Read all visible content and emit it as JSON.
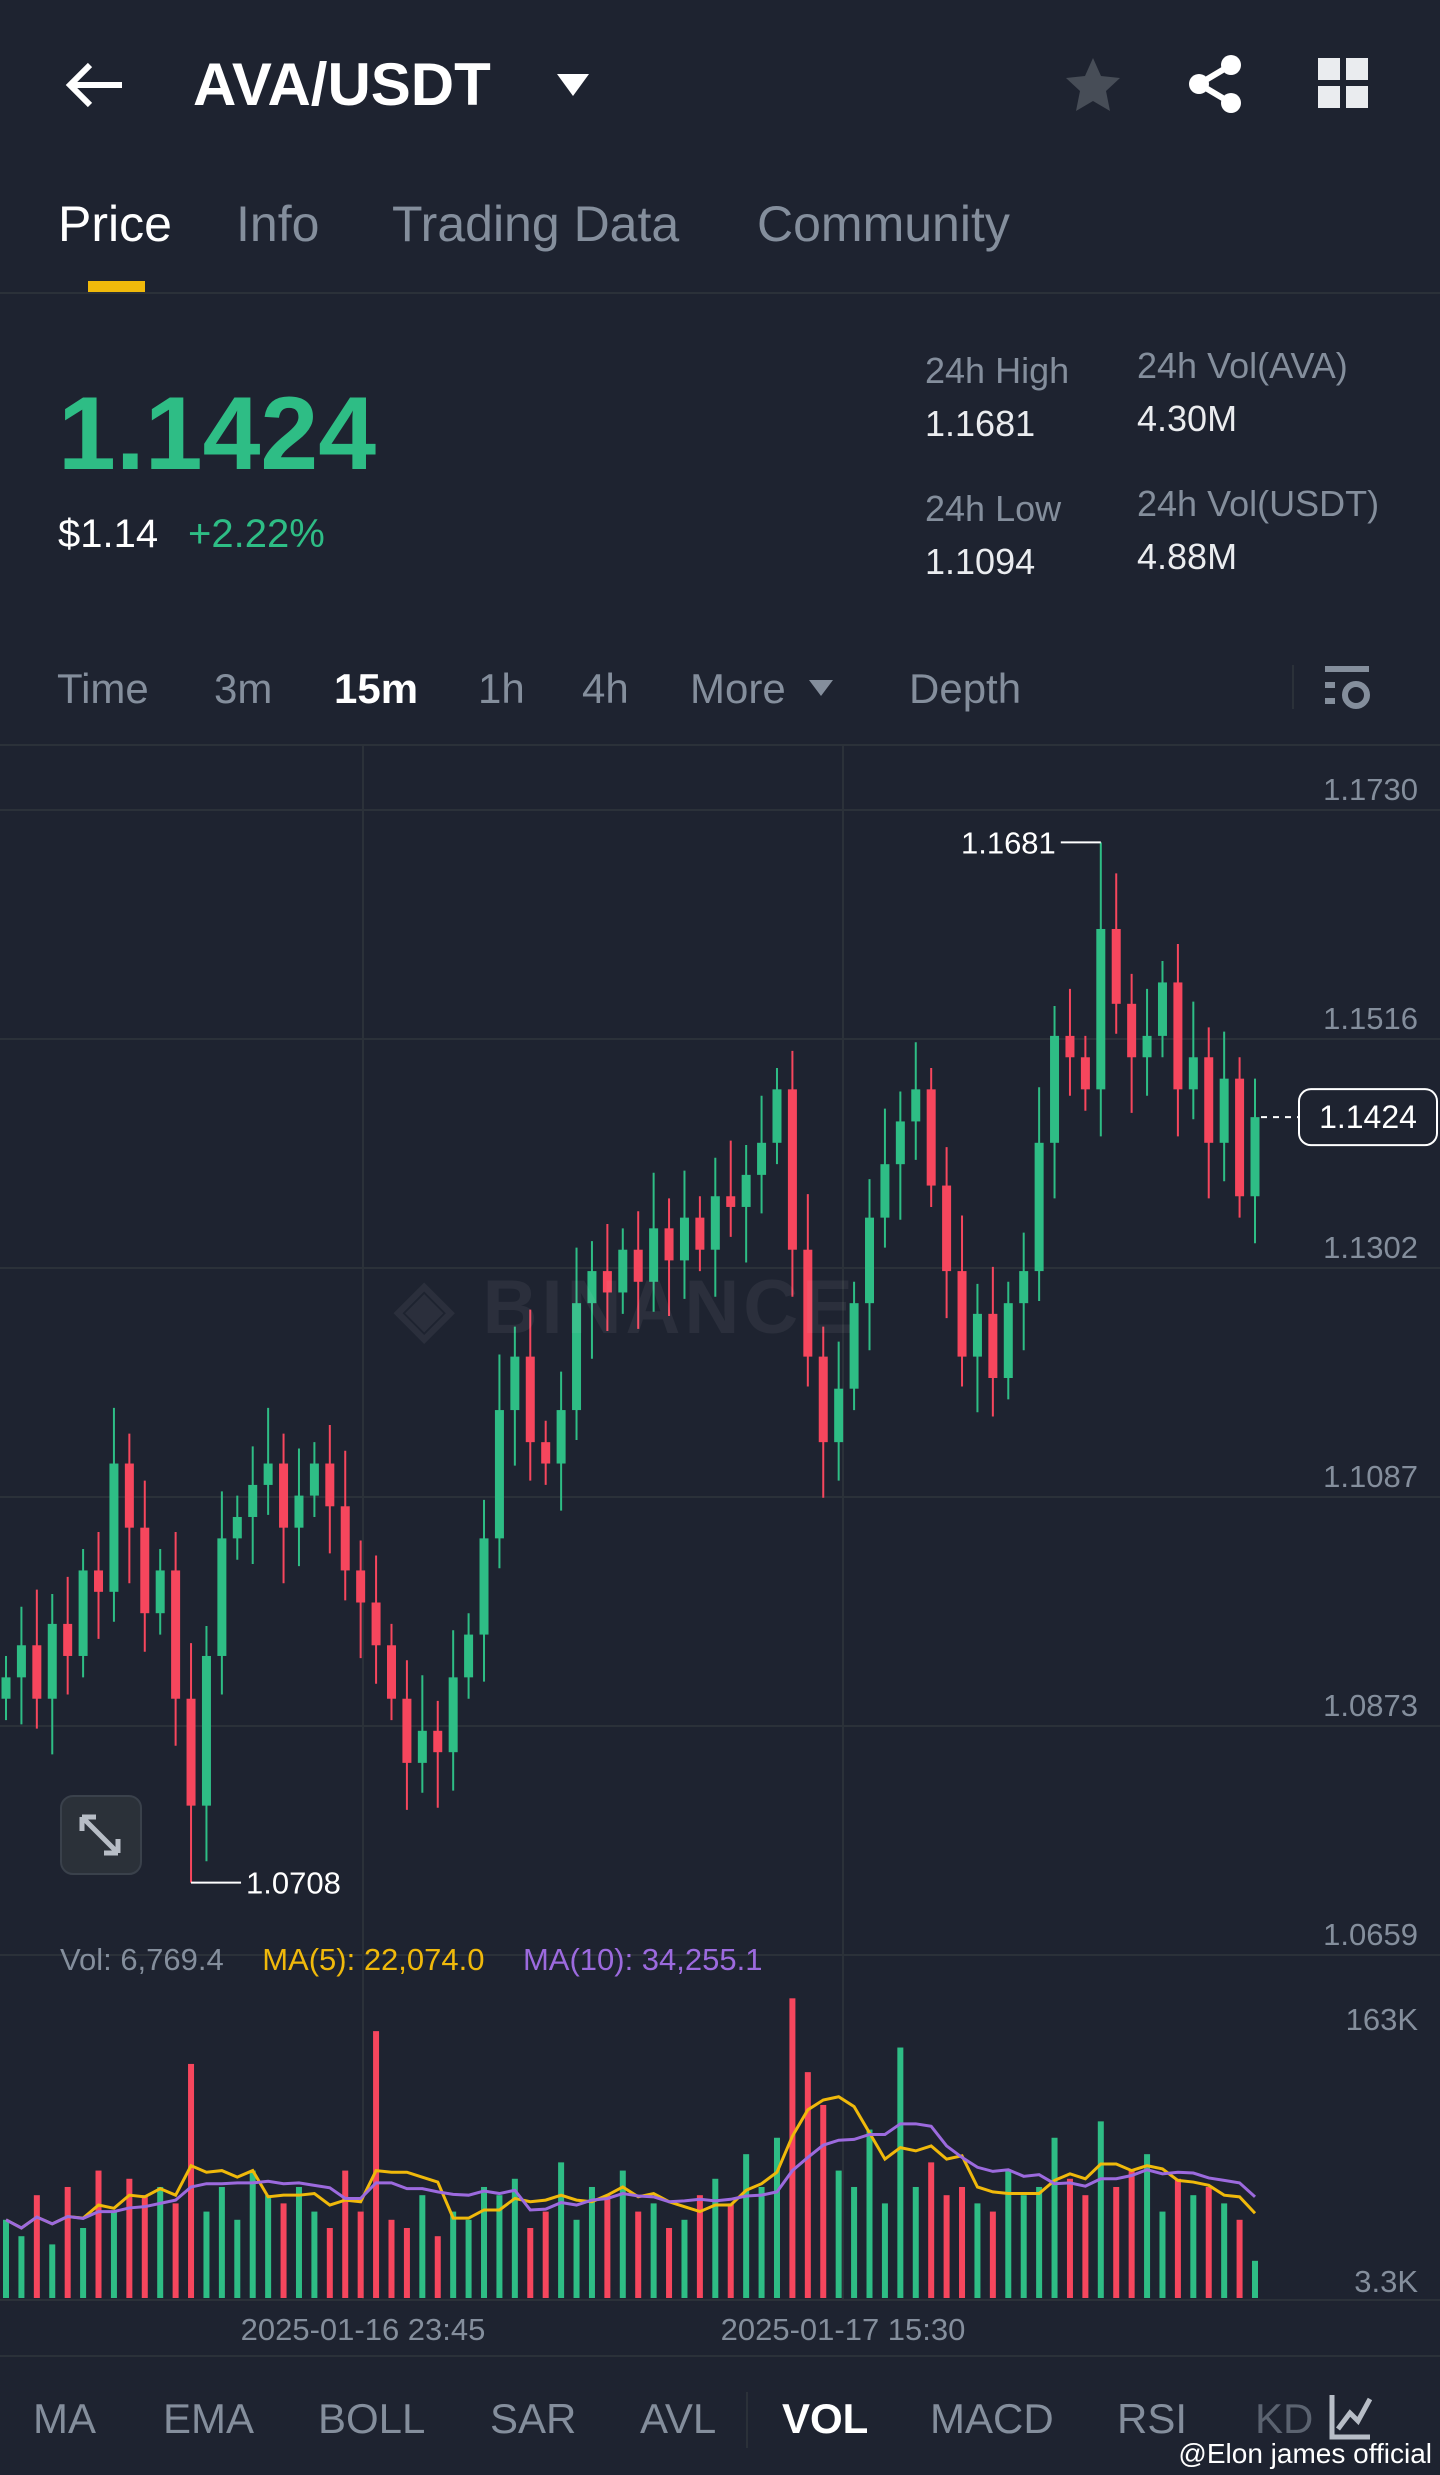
{
  "header": {
    "title": "AVA/USDT",
    "icons": [
      "back-arrow-icon",
      "dropdown-caret-icon",
      "star-icon",
      "share-icon",
      "grid-icon"
    ]
  },
  "tabs": [
    {
      "label": "Price",
      "active": true
    },
    {
      "label": "Info"
    },
    {
      "label": "Trading Data"
    },
    {
      "label": "Community"
    }
  ],
  "ticker": {
    "last_price": "1.1424",
    "usd_price": "$1.14",
    "change": "+2.22%",
    "stats": [
      {
        "label": "24h High",
        "value": "1.1681"
      },
      {
        "label": "24h Vol(AVA)",
        "value": "4.30M"
      },
      {
        "label": "24h Low",
        "value": "1.1094"
      },
      {
        "label": "24h Vol(USDT)",
        "value": "4.88M"
      }
    ]
  },
  "timeframes": [
    {
      "label": "Time"
    },
    {
      "label": "3m"
    },
    {
      "label": "15m",
      "active": true
    },
    {
      "label": "1h"
    },
    {
      "label": "4h"
    },
    {
      "label": "More"
    },
    {
      "label": "Depth"
    }
  ],
  "colors": {
    "up": "#2ebd85",
    "down": "#f6465d",
    "ma5": "#f0b90b",
    "ma10": "#9c6ade",
    "bg": "#1e2330"
  },
  "chart_data": {
    "type": "candlestick",
    "interval": "15m",
    "y_ticks": [
      "1.1730",
      "1.1516",
      "1.1302",
      "1.1087",
      "1.0873",
      "1.0659"
    ],
    "ylim": [
      1.0659,
      1.173
    ],
    "x_ticks": [
      "2025-01-16 23:45",
      "2025-01-17 15:30"
    ],
    "current_price_label": "1.1424",
    "max_label": "1.1681",
    "min_label": "1.0708",
    "extremes": {
      "high": {
        "index": 71,
        "value": 1.1681
      },
      "low": {
        "index": 12,
        "value": 1.0708
      }
    },
    "closes": [
      1.09,
      1.093,
      1.088,
      1.095,
      1.092,
      1.1,
      1.098,
      1.11,
      1.104,
      1.096,
      1.1,
      1.088,
      1.078,
      1.092,
      1.103,
      1.105,
      1.108,
      1.11,
      1.104,
      1.107,
      1.11,
      1.106,
      1.1,
      1.097,
      1.093,
      1.088,
      1.082,
      1.085,
      1.083,
      1.09,
      1.094,
      1.103,
      1.115,
      1.12,
      1.112,
      1.11,
      1.115,
      1.125,
      1.128,
      1.126,
      1.13,
      1.127,
      1.132,
      1.129,
      1.133,
      1.13,
      1.135,
      1.134,
      1.137,
      1.14,
      1.145,
      1.13,
      1.12,
      1.112,
      1.117,
      1.125,
      1.133,
      1.138,
      1.142,
      1.145,
      1.136,
      1.128,
      1.12,
      1.124,
      1.118,
      1.125,
      1.128,
      1.14,
      1.15,
      1.148,
      1.145,
      1.16,
      1.153,
      1.148,
      1.15,
      1.155,
      1.145,
      1.148,
      1.14,
      1.146,
      1.135,
      1.1424
    ],
    "volume": {
      "legend": {
        "vol": "Vol: 6,769.4",
        "ma5": "MA(5): 22,074.0",
        "ma10": "MA(10): 34,255.1"
      },
      "y_ticks": [
        "163K",
        "3.3K"
      ],
      "ylim": [
        3.3,
        163
      ],
      "values_k": [
        40,
        30,
        55,
        25,
        60,
        35,
        70,
        45,
        65,
        55,
        60,
        50,
        135,
        45,
        60,
        40,
        70,
        55,
        50,
        60,
        45,
        35,
        70,
        45,
        155,
        40,
        35,
        55,
        30,
        45,
        40,
        60,
        55,
        65,
        35,
        45,
        75,
        40,
        60,
        55,
        70,
        45,
        50,
        35,
        40,
        55,
        65,
        50,
        80,
        60,
        90,
        175,
        130,
        110,
        70,
        60,
        95,
        50,
        145,
        60,
        75,
        55,
        60,
        50,
        45,
        70,
        55,
        60,
        90,
        65,
        55,
        100,
        60,
        70,
        80,
        45,
        65,
        55,
        60,
        50,
        40,
        15
      ]
    }
  },
  "indicators": [
    {
      "label": "MA"
    },
    {
      "label": "EMA"
    },
    {
      "label": "BOLL"
    },
    {
      "label": "SAR"
    },
    {
      "label": "AVL"
    },
    {
      "label": "VOL",
      "active": true
    },
    {
      "label": "MACD"
    },
    {
      "label": "RSI"
    },
    {
      "label": "KD"
    }
  ],
  "credit": "@Elon james official"
}
